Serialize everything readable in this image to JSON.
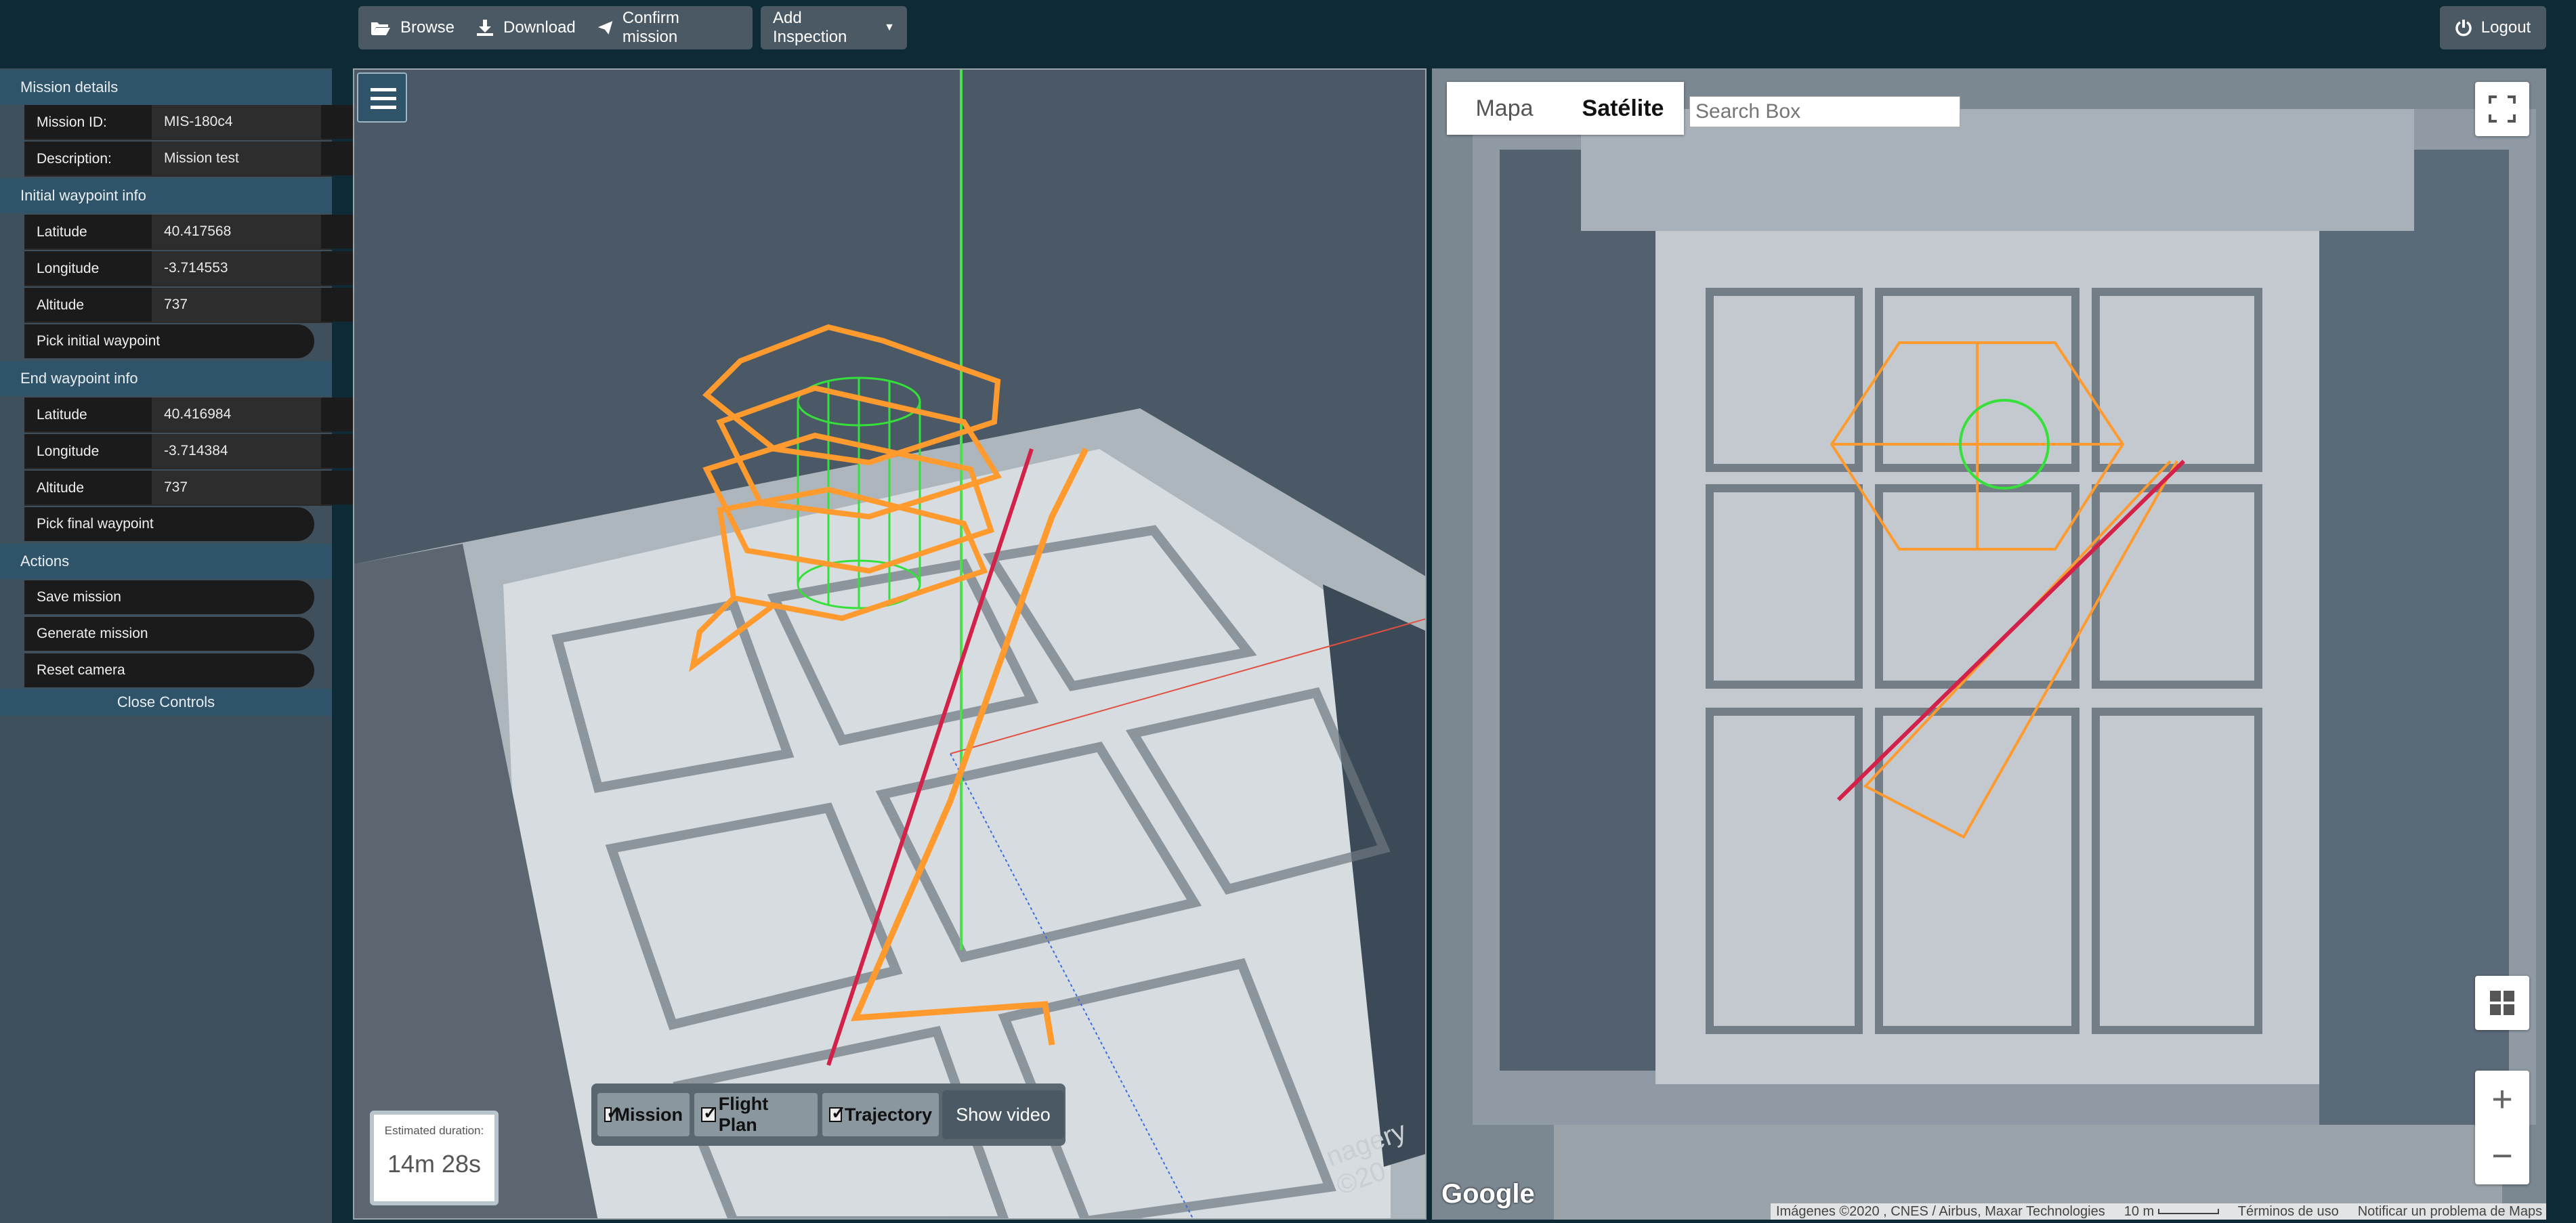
{
  "toolbar": {
    "browse": "Browse",
    "download": "Download",
    "confirm": "Confirm mission",
    "add_inspection": "Add Inspection",
    "logout": "Logout"
  },
  "sidebar": {
    "mission_details": "Mission details",
    "mission_id_label": "Mission ID:",
    "mission_id": "MIS-180c4",
    "description_label": "Description:",
    "description": "Mission test",
    "initial_info": "Initial waypoint info",
    "initial": {
      "lat_label": "Latitude",
      "lat": "40.417568",
      "lon_label": "Longitude",
      "lon": "-3.714553",
      "alt_label": "Altitude",
      "alt": "737"
    },
    "pick_initial": "Pick initial waypoint",
    "end_info": "End waypoint info",
    "end": {
      "lat_label": "Latitude",
      "lat": "40.416984",
      "lon_label": "Longitude",
      "lon": "-3.714384",
      "alt_label": "Altitude",
      "alt": "737"
    },
    "pick_final": "Pick final waypoint",
    "actions": "Actions",
    "save": "Save mission",
    "generate": "Generate mission",
    "reset": "Reset camera",
    "close": "Close Controls"
  },
  "view3d": {
    "duration_label": "Estimated duration:",
    "duration": "14m 28s",
    "chk_mission": "Mission",
    "chk_flight": "Flight Plan",
    "chk_traj": "Trajectory",
    "show_video": "Show video",
    "watermark": "nagery ©20"
  },
  "map": {
    "tab_map": "Mapa",
    "tab_sat": "Satélite",
    "search_placeholder": "Search Box",
    "google": "Google",
    "attribution": "Imágenes ©2020 , CNES / Airbus, Maxar Technologies",
    "scale": "10 m",
    "terms": "Términos de uso",
    "report": "Notificar un problema de Maps"
  }
}
